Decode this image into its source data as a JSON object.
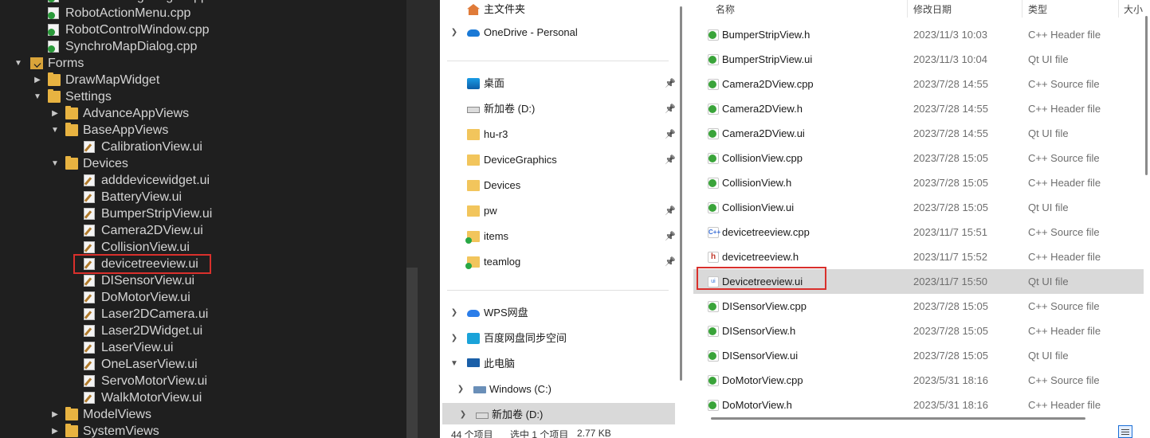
{
  "ide_tree": {
    "items": [
      {
        "label": "DeviceSettingWidget.cpp",
        "kind": "cpp",
        "depth": 2
      },
      {
        "label": "RobotActionMenu.cpp",
        "kind": "cpp",
        "depth": 2
      },
      {
        "label": "RobotControlWindow.cpp",
        "kind": "cpp",
        "depth": 2
      },
      {
        "label": "SynchroMapDialog.cpp",
        "kind": "cpp",
        "depth": 2
      },
      {
        "label": "Forms",
        "kind": "forms",
        "depth": 0,
        "expanded": true
      },
      {
        "label": "DrawMapWidget",
        "kind": "folder",
        "depth": 1,
        "expanded": false
      },
      {
        "label": "Settings",
        "kind": "folder",
        "depth": 1,
        "expanded": true
      },
      {
        "label": "AdvanceAppViews",
        "kind": "folder",
        "depth": 2,
        "expanded": false
      },
      {
        "label": "BaseAppViews",
        "kind": "folder",
        "depth": 2,
        "expanded": true
      },
      {
        "label": "CalibrationView.ui",
        "kind": "ui",
        "depth": 3
      },
      {
        "label": "Devices",
        "kind": "folder",
        "depth": 2,
        "expanded": true
      },
      {
        "label": "adddevicewidget.ui",
        "kind": "ui",
        "depth": 3
      },
      {
        "label": "BatteryView.ui",
        "kind": "ui",
        "depth": 3
      },
      {
        "label": "BumperStripView.ui",
        "kind": "ui",
        "depth": 3
      },
      {
        "label": "Camera2DView.ui",
        "kind": "ui",
        "depth": 3
      },
      {
        "label": "CollisionView.ui",
        "kind": "ui",
        "depth": 3
      },
      {
        "label": "devicetreeview.ui",
        "kind": "ui",
        "depth": 3,
        "highlighted": true
      },
      {
        "label": "DISensorView.ui",
        "kind": "ui",
        "depth": 3
      },
      {
        "label": "DoMotorView.ui",
        "kind": "ui",
        "depth": 3
      },
      {
        "label": "Laser2DCamera.ui",
        "kind": "ui",
        "depth": 3
      },
      {
        "label": "Laser2DWidget.ui",
        "kind": "ui",
        "depth": 3
      },
      {
        "label": "LaserView.ui",
        "kind": "ui",
        "depth": 3
      },
      {
        "label": "OneLaserView.ui",
        "kind": "ui",
        "depth": 3
      },
      {
        "label": "ServoMotorView.ui",
        "kind": "ui",
        "depth": 3
      },
      {
        "label": "WalkMotorView.ui",
        "kind": "ui",
        "depth": 3
      },
      {
        "label": "ModelViews",
        "kind": "folder",
        "depth": 2,
        "expanded": false
      },
      {
        "label": "SystemViews",
        "kind": "folder",
        "depth": 2,
        "expanded": false
      }
    ]
  },
  "nav": {
    "items": [
      {
        "label": "主文件夹",
        "icon": "home-icon",
        "cls": "ic-home",
        "chevron": false,
        "pin": false
      },
      {
        "label": "OneDrive - Personal",
        "icon": "onedrive-icon",
        "cls": "ic-cloud",
        "chevron": true,
        "pin": false
      },
      {
        "label": "桌面",
        "icon": "desktop-icon",
        "cls": "ic-desk",
        "chevron": false,
        "pin": true
      },
      {
        "label": "新加卷 (D:)",
        "icon": "drive-icon",
        "cls": "ic-drive",
        "chevron": false,
        "pin": true
      },
      {
        "label": "hu-r3",
        "icon": "folder-icon",
        "cls": "ic-folder",
        "chevron": false,
        "pin": true
      },
      {
        "label": "DeviceGraphics",
        "icon": "folder-icon",
        "cls": "ic-folder",
        "chevron": false,
        "pin": true
      },
      {
        "label": "Devices",
        "icon": "folder-icon",
        "cls": "ic-folder",
        "chevron": false,
        "pin": false
      },
      {
        "label": "pw",
        "icon": "folder-icon",
        "cls": "ic-folder",
        "chevron": false,
        "pin": true
      },
      {
        "label": "items",
        "icon": "synced-folder-icon",
        "cls": "ic-folder-g",
        "chevron": false,
        "pin": true
      },
      {
        "label": "teamlog",
        "icon": "synced-folder-icon",
        "cls": "ic-folder-g",
        "chevron": false,
        "pin": true
      },
      {
        "label": "WPS网盘",
        "icon": "wps-cloud-icon",
        "cls": "ic-wps",
        "chevron": true,
        "pin": false
      },
      {
        "label": "百度网盘同步空间",
        "icon": "baidu-netdisk-icon",
        "cls": "ic-baidu",
        "chevron": true,
        "pin": false
      },
      {
        "label": "此电脑",
        "icon": "computer-icon",
        "cls": "ic-pc",
        "chevron": true,
        "expanded": true,
        "pin": false
      },
      {
        "label": "Windows  (C:)",
        "icon": "windows-drive-icon",
        "cls": "ic-win",
        "chevron": true,
        "pin": false,
        "indent": true
      },
      {
        "label": "新加卷 (D:)",
        "icon": "drive-icon",
        "cls": "ic-drive",
        "chevron": true,
        "pin": false,
        "indent": true,
        "selected": true
      }
    ]
  },
  "list": {
    "columns": {
      "name": "名称",
      "date": "修改日期",
      "type": "类型",
      "size": "大小"
    },
    "rows": [
      {
        "name": "BumperStripView.h",
        "date": "2023/11/3 10:03",
        "type": "C++ Header file",
        "icon": "qt-header-icon",
        "cls": "ic-qtcpp"
      },
      {
        "name": "BumperStripView.ui",
        "date": "2023/11/3 10:04",
        "type": "Qt UI file",
        "icon": "qt-ui-icon",
        "cls": "ic-qtcpp"
      },
      {
        "name": "Camera2DView.cpp",
        "date": "2023/7/28 14:55",
        "type": "C++ Source file",
        "icon": "qt-source-icon",
        "cls": "ic-qtcpp"
      },
      {
        "name": "Camera2DView.h",
        "date": "2023/7/28 14:55",
        "type": "C++ Header file",
        "icon": "qt-header-icon",
        "cls": "ic-qtcpp"
      },
      {
        "name": "Camera2DView.ui",
        "date": "2023/7/28 14:55",
        "type": "Qt UI file",
        "icon": "qt-ui-icon",
        "cls": "ic-qtcpp"
      },
      {
        "name": "CollisionView.cpp",
        "date": "2023/7/28 15:05",
        "type": "C++ Source file",
        "icon": "qt-source-icon",
        "cls": "ic-qtcpp"
      },
      {
        "name": "CollisionView.h",
        "date": "2023/7/28 15:05",
        "type": "C++ Header file",
        "icon": "qt-header-icon",
        "cls": "ic-qtcpp"
      },
      {
        "name": "CollisionView.ui",
        "date": "2023/7/28 15:05",
        "type": "Qt UI file",
        "icon": "qt-ui-icon",
        "cls": "ic-qtcpp"
      },
      {
        "name": "devicetreeview.cpp",
        "date": "2023/11/7 15:51",
        "type": "C++ Source file",
        "icon": "cpp-file-icon",
        "cls": "ic-c",
        "glyph": "C++"
      },
      {
        "name": "devicetreeview.h",
        "date": "2023/11/7 15:52",
        "type": "C++ Header file",
        "icon": "h-file-icon",
        "cls": "ic-h",
        "glyph": "h"
      },
      {
        "name": "Devicetreeview.ui",
        "date": "2023/11/7 15:50",
        "type": "Qt UI file",
        "icon": "ui-file-icon",
        "cls": "ic-ui",
        "glyph": "ui",
        "selected": true
      },
      {
        "name": "DISensorView.cpp",
        "date": "2023/7/28 15:05",
        "type": "C++ Source file",
        "icon": "qt-source-icon",
        "cls": "ic-qtcpp"
      },
      {
        "name": "DISensorView.h",
        "date": "2023/7/28 15:05",
        "type": "C++ Header file",
        "icon": "qt-header-icon",
        "cls": "ic-qtcpp"
      },
      {
        "name": "DISensorView.ui",
        "date": "2023/7/28 15:05",
        "type": "Qt UI file",
        "icon": "qt-ui-icon",
        "cls": "ic-qtcpp"
      },
      {
        "name": "DoMotorView.cpp",
        "date": "2023/5/31 18:16",
        "type": "C++ Source file",
        "icon": "qt-source-icon",
        "cls": "ic-qtcpp"
      },
      {
        "name": "DoMotorView.h",
        "date": "2023/5/31 18:16",
        "type": "C++ Header file",
        "icon": "qt-header-icon",
        "cls": "ic-qtcpp"
      }
    ]
  },
  "status": {
    "count": "44 个项目",
    "selection": "选中 1 个项目",
    "size": "2.77 KB"
  },
  "colors": {
    "ide_bg": "#1f1f1f",
    "highlight_border": "#d9302c",
    "selection_bg": "#d9d9d9"
  }
}
